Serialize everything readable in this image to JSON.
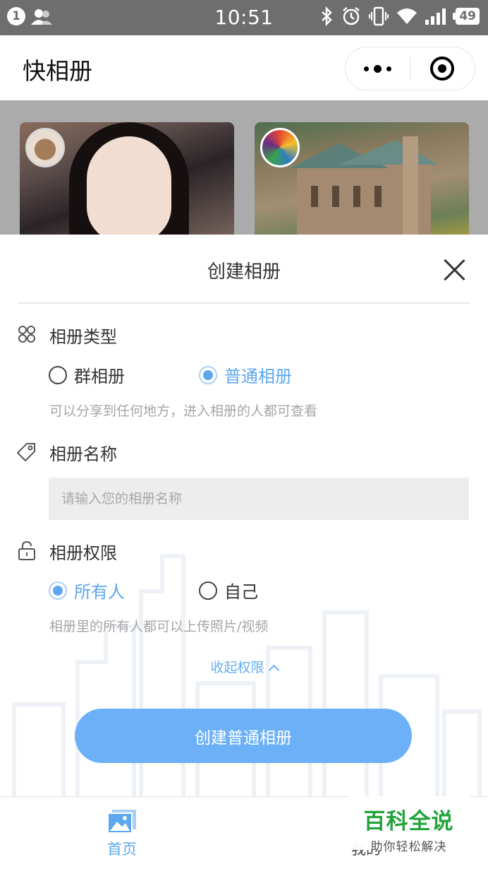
{
  "status_bar": {
    "notification_count": "1",
    "time": "10:51",
    "battery": "49"
  },
  "nav": {
    "title": "快相册"
  },
  "sheet": {
    "title": "创建相册",
    "album_type": {
      "label": "相册类型",
      "options": [
        "群相册",
        "普通相册"
      ],
      "selected": "普通相册",
      "hint": "可以分享到任何地方，进入相册的人都可查看"
    },
    "album_name": {
      "label": "相册名称",
      "placeholder": "请输入您的相册名称",
      "value": ""
    },
    "permission": {
      "label": "相册权限",
      "options": [
        "所有人",
        "自己"
      ],
      "selected": "所有人",
      "hint": "相册里的所有人都可以上传照片/视频"
    },
    "collapse_label": "收起权限",
    "create_button": "创建普通相册"
  },
  "tabbar": {
    "items": [
      {
        "label": "首页",
        "active": true
      },
      {
        "label": "我的",
        "active": false
      }
    ]
  },
  "watermark": {
    "title": "百科全说",
    "subtitle": "助你轻松解决"
  },
  "colors": {
    "accent": "#5da7ee",
    "button": "#6cb1f7",
    "status_bar": "#6e6e6e"
  }
}
